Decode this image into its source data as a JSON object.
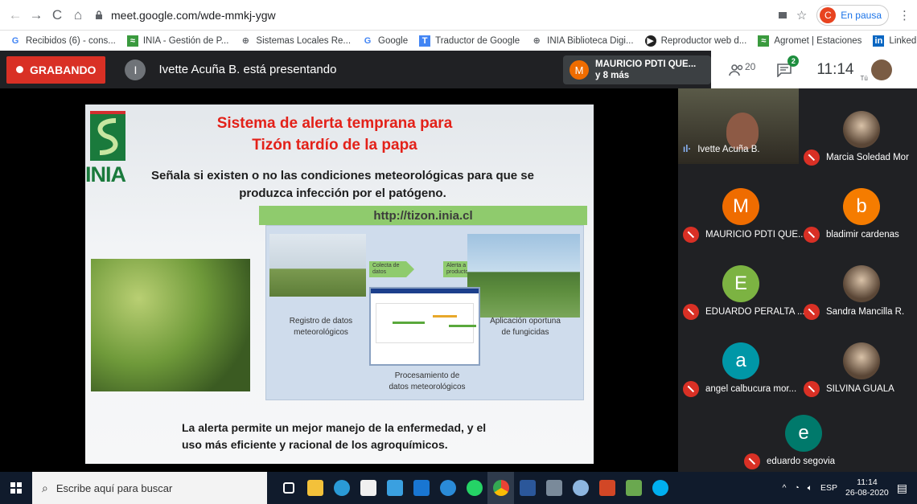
{
  "browser": {
    "url": "meet.google.com/wde-mmkj-ygw",
    "profile_initial": "C",
    "profile_status": "En pausa",
    "bookmarks": [
      "Recibidos (6) - cons...",
      "INIA - Gestión de P...",
      "Sistemas Locales Re...",
      "Google",
      "Traductor de Google",
      "INIA Biblioteca Digi...",
      "Reproductor web d...",
      "Agromet | Estaciones",
      "LinkedIn"
    ],
    "bookmarks_more": "»"
  },
  "meet": {
    "recording_label": "GRABANDO",
    "presenter_initial": "I",
    "presenting_text": "Ivette Acuña B. está presentando",
    "notification": {
      "initial": "M",
      "line1": "MAURICIO PDTI QUE...",
      "line2": "y 8 más"
    },
    "participants_count": "20",
    "chat_badge": "2",
    "clock": "11:14",
    "self_label": "Tú",
    "slide": {
      "logo_text": "INIA",
      "title_line1": "Sistema de alerta temprana para",
      "title_line2": "Tizón tardío de la papa",
      "subtitle_line1": "Señala si existen o no las condiciones meteorológicas para que se",
      "subtitle_line2": "produzca infección por el patógeno.",
      "url": "http://tizon.inia.cl",
      "arrow1": "Colecta de datos",
      "arrow2": "Alerta a productores",
      "label_registro_1": "Registro de datos",
      "label_registro_2": "meteorológicos",
      "label_aplicacion_1": "Aplicación oportuna",
      "label_aplicacion_2": "de fungicidas",
      "label_proc_1": "Procesamiento de",
      "label_proc_2": "datos meteorológicos",
      "footer_line1": "La alerta permite un mejor manejo de la enfermedad, y el",
      "footer_line2": "uso más eficiente y racional de los agroquímicos."
    },
    "participants": [
      {
        "name": "Ivette Acuña B.",
        "type": "video"
      },
      {
        "name": "Marcia Soledad Mor",
        "type": "photo"
      },
      {
        "name": "MAURICIO PDTI QUE...",
        "initial": "M",
        "color": "#ef6c00"
      },
      {
        "name": "bladimir cardenas",
        "initial": "b",
        "color": "#f57c00"
      },
      {
        "name": "EDUARDO PERALTA ...",
        "initial": "E",
        "color": "#7cb342"
      },
      {
        "name": "Sandra Mancilla R.",
        "type": "photo"
      },
      {
        "name": "angel calbucura mor...",
        "initial": "a",
        "color": "#0097a7"
      },
      {
        "name": "SILVINA GUALA",
        "type": "photo"
      },
      {
        "name": "eduardo segovia",
        "initial": "e",
        "color": "#00796b"
      }
    ]
  },
  "taskbar": {
    "search_placeholder": "Escribe aquí para buscar",
    "lang": "ESP",
    "time": "11:14",
    "date": "26-08-2020"
  }
}
